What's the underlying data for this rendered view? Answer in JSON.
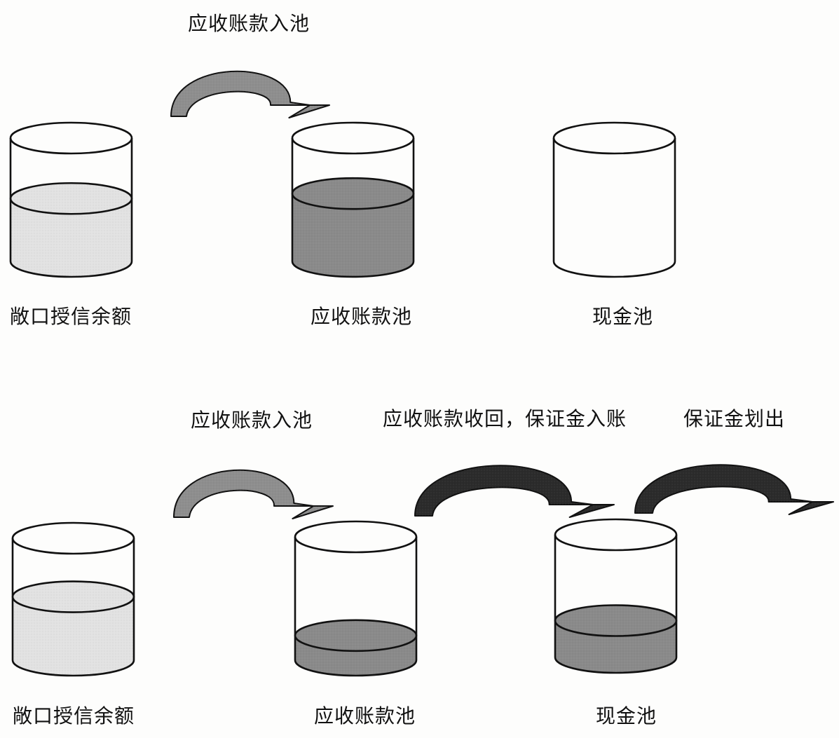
{
  "colors": {
    "stroke": "#111111",
    "credit_fill": "#e2e2e2",
    "receivable_fill": "#8a8a8a",
    "cash_fill": "#8a8a8a",
    "arrow_light": "#8e8e8e",
    "arrow_dark": "#2b2b2b",
    "background": "#fdfdfc"
  },
  "panels": [
    {
      "id": "top",
      "arrows": [
        {
          "label": "应收账款入池",
          "shade": "light"
        }
      ],
      "containers": [
        {
          "label": "敞口授信余额",
          "fill_level": 0.51,
          "fill_color": "credit"
        },
        {
          "label": "应收账款池",
          "fill_level": 0.55,
          "fill_color": "receivable"
        },
        {
          "label": "现金池",
          "fill_level": 0,
          "fill_color": "cash"
        }
      ]
    },
    {
      "id": "bottom",
      "arrows": [
        {
          "label": "应收账款入池",
          "shade": "light"
        },
        {
          "label": "应收账款收回，保证金入账",
          "shade": "dark"
        },
        {
          "label": "保证金划出",
          "shade": "dark"
        }
      ],
      "containers": [
        {
          "label": "敞口授信余额",
          "fill_level": 0.52,
          "fill_color": "credit"
        },
        {
          "label": "应收账款池",
          "fill_level": 0.2,
          "fill_color": "receivable"
        },
        {
          "label": "现金池",
          "fill_level": 0.3,
          "fill_color": "cash"
        }
      ]
    }
  ]
}
